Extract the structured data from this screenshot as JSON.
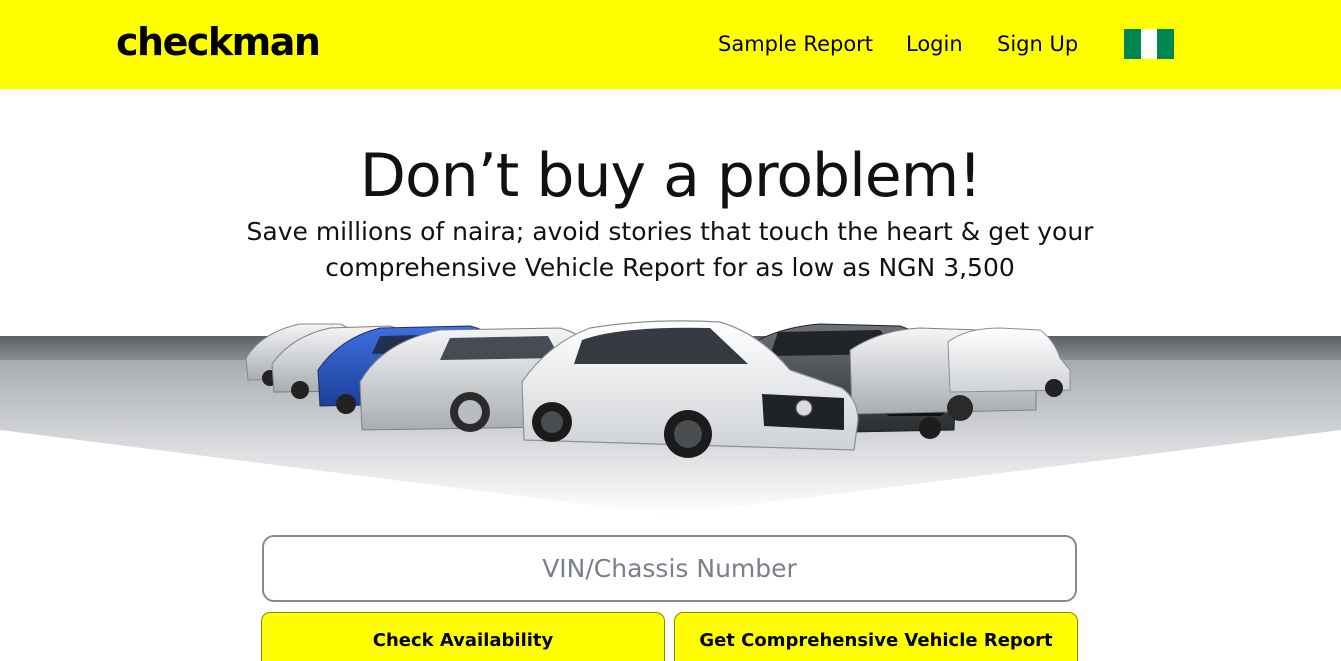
{
  "header": {
    "logo_text": "checkman",
    "nav": {
      "sample_report": "Sample Report",
      "login": "Login",
      "sign_up": "Sign Up"
    },
    "flag_icon": "nigeria-flag-icon",
    "colors": {
      "bar": "#ffff00",
      "flag_green": "#008751"
    }
  },
  "hero": {
    "title": "Don’t buy a problem!",
    "subtitle": "Save millions of naira; avoid stories that touch the heart & get your comprehensive Vehicle Report for as low as NGN 3,500",
    "image": "lineup-of-cars"
  },
  "search": {
    "placeholder": "VIN/Chassis Number",
    "value": ""
  },
  "actions": {
    "check_label": "Check Availability",
    "report_label": "Get Comprehensive Vehicle Report",
    "accent": "#ffff00"
  }
}
